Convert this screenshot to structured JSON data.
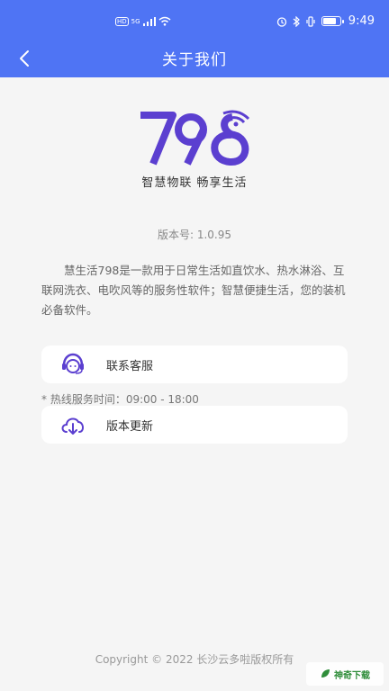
{
  "status_bar": {
    "left_badge": "HD",
    "network": "5G",
    "time": "9:49",
    "battery_level": 0.7
  },
  "nav": {
    "title": "关于我们",
    "back_icon": "chevron-left-icon"
  },
  "logo": {
    "text": "798",
    "slogan": "智慧物联 畅享生活",
    "color": "#5b3fd0"
  },
  "version": "版本号: 1.0.95",
  "description": "慧生活798是一款用于日常生活如直饮水、热水淋浴、互联网洗衣、电吹风等的服务性软件；智慧便捷生活，您的装机必备软件。",
  "menu": {
    "contact": {
      "label": "联系客服",
      "icon": "customer-service-icon"
    },
    "hotline": "* 热线服务时间：09:00 - 18:00",
    "update": {
      "label": "版本更新",
      "icon": "cloud-download-icon"
    }
  },
  "footer": {
    "copyright": "Copyright © 2022 长沙云多啦版权所有"
  },
  "watermark": {
    "text": "神奇下载"
  },
  "colors": {
    "header": "#4f74f4",
    "accent": "#5b3fd0",
    "background": "#f5f5f5"
  }
}
